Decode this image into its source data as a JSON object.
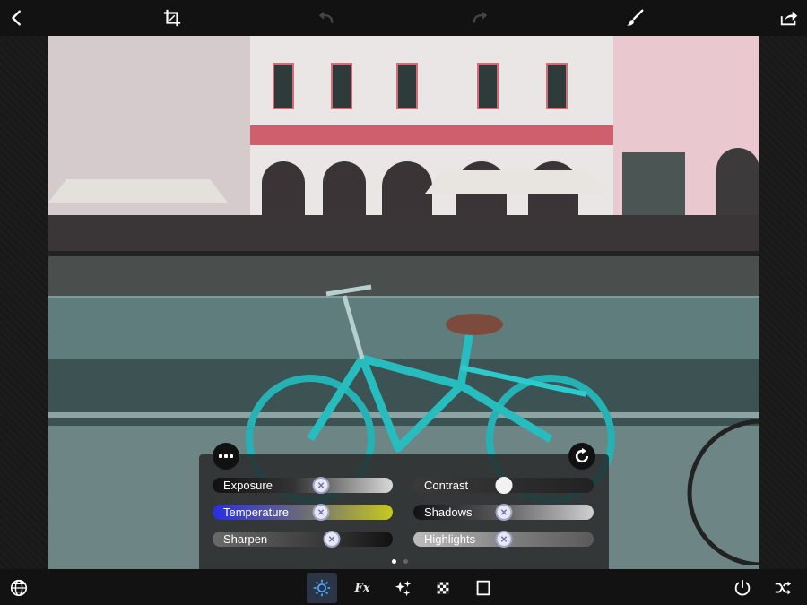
{
  "toolbar_top": {
    "back_icon": "chevron-left-icon",
    "crop_icon": "crop-icon",
    "undo_icon": "undo-icon",
    "redo_icon": "redo-icon",
    "brush_icon": "brush-icon",
    "share_icon": "share-icon"
  },
  "panel": {
    "sliders": [
      {
        "label": "Exposure",
        "value": 0.6
      },
      {
        "label": "Contrast",
        "value": 0.5
      },
      {
        "label": "Temperature",
        "value": 0.6
      },
      {
        "label": "Shadows",
        "value": 0.5
      },
      {
        "label": "Sharpen",
        "value": 0.66
      },
      {
        "label": "Highlights",
        "value": 0.5
      }
    ],
    "pages": 2,
    "active_page": 1
  },
  "toolbar_bottom": {
    "globe_icon": "globe-icon",
    "adjust_icon": "sun-icon",
    "fx_label": "Fx",
    "sparkle_icon": "sparkles-icon",
    "checker_icon": "checkerboard-icon",
    "border_icon": "square-frame-icon",
    "power_icon": "power-icon",
    "shuffle_icon": "shuffle-icon"
  },
  "colors": {
    "accent_blue": "#2a2ee0",
    "accent_yellow": "#c8c820",
    "panel_bg": "#262626",
    "toolbar_bg": "#121212"
  }
}
